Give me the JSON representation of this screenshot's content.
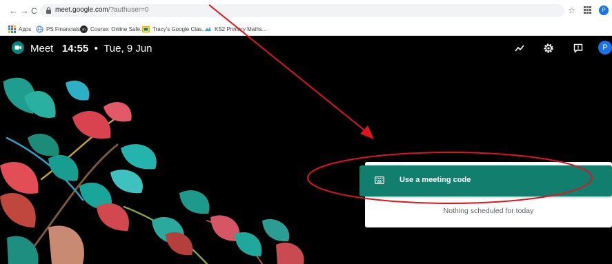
{
  "browser": {
    "nav": {
      "back": "←",
      "forward": "→",
      "reload": "C"
    },
    "url_host": "meet.google.com",
    "url_path": "/?authuser=0",
    "profile_letter": "P",
    "bookmarks": [
      {
        "label": "Apps",
        "icon": "apps-grid-icon"
      },
      {
        "label": "PS Financials",
        "icon": "globe-icon"
      },
      {
        "label": "Course: Online Safe...",
        "icon": "course-icon"
      },
      {
        "label": "Tracy's Google Clas...",
        "icon": "classroom-icon"
      },
      {
        "label": "KS2 Primary Maths...",
        "icon": "ks2-icon"
      }
    ]
  },
  "meet": {
    "app_name": "Meet",
    "time": "14:55",
    "separator": "•",
    "date": "Tue, 9 Jun",
    "avatar_letter": "P",
    "header_icons": [
      "activity-icon",
      "settings-icon",
      "feedback-icon"
    ],
    "meeting_code_label": "Use a meeting code",
    "empty_schedule_text": "Nothing scheduled for today"
  },
  "colors": {
    "accent_green": "#127f6e",
    "annotation_red": "#e0141e",
    "profile_blue": "#1a73e8"
  }
}
